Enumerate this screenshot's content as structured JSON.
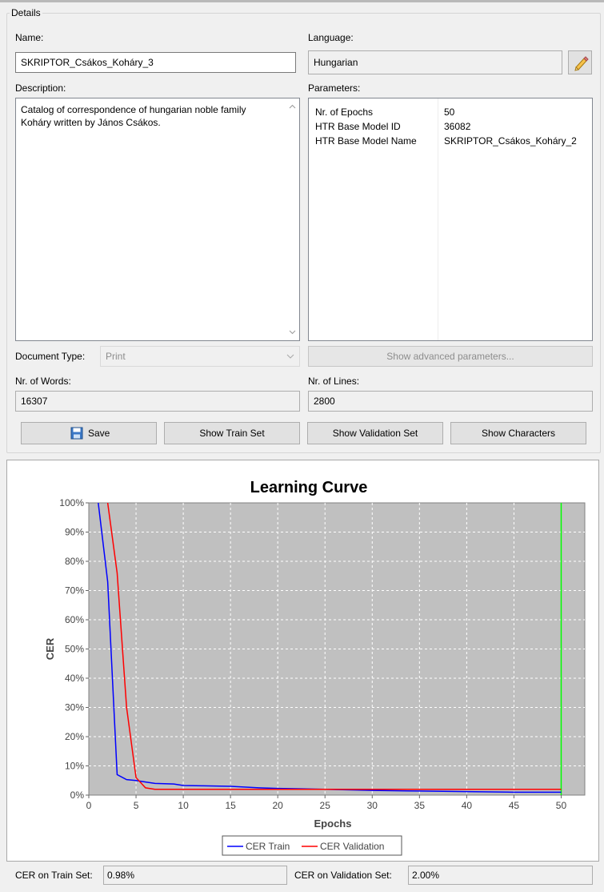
{
  "details": {
    "title": "Details",
    "name_label": "Name:",
    "name_value": "SKRIPTOR_Csákos_Koháry_3",
    "language_label": "Language:",
    "language_value": "Hungarian",
    "description_label": "Description:",
    "description_value": "Catalog of correspondence of hungarian noble family Koháry written by János Csákos.",
    "parameters_label": "Parameters:",
    "parameters": [
      {
        "key": "Nr. of Epochs",
        "value": "50"
      },
      {
        "key": "HTR Base Model ID",
        "value": "36082"
      },
      {
        "key": "HTR Base Model Name",
        "value": "SKRIPTOR_Csákos_Koháry_2"
      }
    ],
    "document_type_label": "Document Type:",
    "document_type_value": "Print",
    "advanced_button": "Show advanced parameters...",
    "words_label": "Nr. of Words:",
    "words_value": "16307",
    "lines_label": "Nr. of Lines:",
    "lines_value": "2800"
  },
  "buttons": {
    "save": "Save",
    "train_set": "Show Train Set",
    "validation_set": "Show Validation Set",
    "characters": "Show Characters"
  },
  "icons": {
    "edit": "pencil-icon",
    "save": "floppy-disk-icon",
    "scroll_up": "chevron-up-icon",
    "scroll_down": "chevron-down-icon",
    "dropdown": "chevron-down-icon"
  },
  "chart_data": {
    "type": "line",
    "title": "Learning Curve",
    "xlabel": "Epochs",
    "ylabel": "CER",
    "xlim": [
      0,
      52.5
    ],
    "ylim": [
      0,
      100
    ],
    "x_ticks": [
      "0",
      "5",
      "10",
      "15",
      "20",
      "25",
      "30",
      "35",
      "40",
      "45",
      "50"
    ],
    "y_ticks": [
      "0%",
      "10%",
      "20%",
      "30%",
      "40%",
      "50%",
      "60%",
      "70%",
      "80%",
      "90%",
      "100%"
    ],
    "grid": true,
    "legend": "bottom-center",
    "series": [
      {
        "name": "CER Train",
        "color": "#0000ff",
        "x": [
          1,
          2,
          3,
          4,
          5,
          6,
          7,
          8,
          9,
          10,
          12,
          15,
          18,
          20,
          25,
          30,
          35,
          40,
          45,
          50
        ],
        "values": [
          100,
          73,
          7,
          5.3,
          5,
          4.5,
          4,
          3.9,
          3.8,
          3.3,
          3.2,
          3,
          2.5,
          2.3,
          2,
          1.6,
          1.4,
          1.2,
          1.0,
          0.98
        ]
      },
      {
        "name": "CER Validation",
        "color": "#ff0000",
        "x": [
          2,
          3,
          4,
          5,
          6,
          7,
          8,
          10,
          15,
          20,
          25,
          30,
          35,
          40,
          45,
          50
        ],
        "values": [
          100,
          76,
          30,
          6,
          2.5,
          2.0,
          2.0,
          2.0,
          2.0,
          2.0,
          2.0,
          2.0,
          2.0,
          2.0,
          2.0,
          2.0
        ]
      }
    ],
    "marker_line": {
      "x": 50,
      "color": "#00ff00"
    }
  },
  "footer": {
    "cer_train_label": "CER on Train Set:",
    "cer_train_value": "0.98%",
    "cer_validation_label": "CER on Validation Set:",
    "cer_validation_value": "2.00%"
  }
}
